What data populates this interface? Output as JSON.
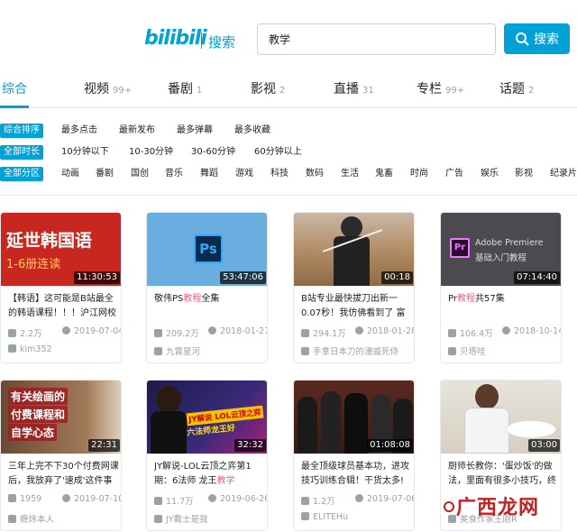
{
  "header": {
    "logo_text": "bilibili",
    "logo_search": "搜索",
    "search_value": "教学",
    "search_button": "搜索"
  },
  "tabs": [
    {
      "label": "综合",
      "count": ""
    },
    {
      "label": "视频",
      "count": "99+"
    },
    {
      "label": "番剧",
      "count": "1"
    },
    {
      "label": "影视",
      "count": "2"
    },
    {
      "label": "直播",
      "count": "31"
    },
    {
      "label": "专栏",
      "count": "99+"
    },
    {
      "label": "话题",
      "count": "2"
    }
  ],
  "filters": {
    "sort": {
      "badge": "综合排序",
      "options": [
        "最多点击",
        "最新发布",
        "最多弹幕",
        "最多收藏"
      ]
    },
    "duration": {
      "badge": "全部时长",
      "options": [
        "10分钟以下",
        "10-30分钟",
        "30-60分钟",
        "60分钟以上"
      ]
    },
    "zone": {
      "badge": "全部分区",
      "options": [
        "动画",
        "番剧",
        "国创",
        "音乐",
        "舞蹈",
        "游戏",
        "科技",
        "数码",
        "生活",
        "鬼畜",
        "时尚",
        "广告",
        "娱乐",
        "影视",
        "纪录片"
      ]
    }
  },
  "videos": [
    {
      "thumb_text": "延世韩国语",
      "thumb_sub": "1-6册连读",
      "duration": "11:30:53",
      "title_pre": "【韩语】这可能是B站最全的韩语课程！！！沪江网校",
      "title_em": "",
      "title_post": "",
      "views": "2.2万",
      "date": "2019-07-04",
      "author": "kim352"
    },
    {
      "thumb_text": "Ps",
      "thumb_sub": "",
      "duration": "53:47:06",
      "title_pre": "敬伟PS",
      "title_em": "教程",
      "title_post": "全集",
      "views": "209.2万",
      "date": "2018-01-27",
      "author": "九霄星河"
    },
    {
      "thumb_text": "",
      "thumb_sub": "",
      "duration": "00:18",
      "title_pre": "B站专业最快拔刀出新一0.07秒！我仿佛看到了 富",
      "title_em": "",
      "title_post": "",
      "views": "294.1万",
      "date": "2018-01-28",
      "author": "手拿日本刀的漫威死侍"
    },
    {
      "thumb_text": "Adobe Premiere",
      "thumb_sub": "基础入门教程",
      "duration": "07:14:40",
      "title_pre": "Pr",
      "title_em": "教程",
      "title_post": "共57集",
      "views": "106.4万",
      "date": "2018-10-14",
      "author": "贝塔哇"
    },
    {
      "thumb_text": "有关绘画的",
      "thumb_sub": "付费课程和",
      "thumb_sub2": "自学心态",
      "duration": "22:31",
      "title_pre": "三年上完不下30个付费网课后，我放弃了'速成'这件事",
      "title_em": "",
      "title_post": "",
      "views": "1959",
      "date": "2019-07-10",
      "author": "瘾炜本人"
    },
    {
      "thumb_text": "JY解说 LOL云顶之弈",
      "thumb_sub": "六法师龙王好",
      "duration": "32:32",
      "title_pre": "JY解说-LOL云顶之弈第1期：6法师 龙王",
      "title_em": "教学",
      "title_post": "",
      "views": "11.7万",
      "date": "2019-06-26",
      "author": "JY戴士是我"
    },
    {
      "thumb_text": "",
      "thumb_sub": "",
      "duration": "01:08:08",
      "title_pre": "最全顶级球员基本功，进攻技巧训练合辑！干货太多!",
      "title_em": "",
      "title_post": "",
      "views": "1.2万",
      "date": "2019-07-06",
      "author": "ELITEHu"
    },
    {
      "thumb_text": "",
      "thumb_sub": "",
      "duration": "03:00",
      "title_pre": "厨师长教你：'蛋炒饭'的做法，里面有很多小技巧，终",
      "title_em": "",
      "title_post": "",
      "views": "",
      "date": "",
      "author": "美食作家王刚R"
    }
  ],
  "watermark": "广西龙网"
}
